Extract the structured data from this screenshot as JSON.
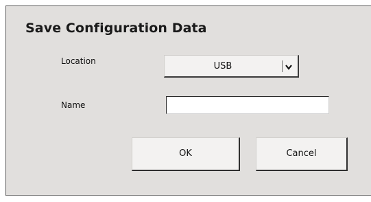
{
  "dialog": {
    "title": "Save Configuration Data",
    "location": {
      "label": "Location",
      "selected": "USB"
    },
    "name": {
      "label": "Name",
      "value": ""
    },
    "buttons": {
      "ok": "OK",
      "cancel": "Cancel"
    }
  },
  "icons": {
    "dropdown": "chevron-down-icon"
  }
}
